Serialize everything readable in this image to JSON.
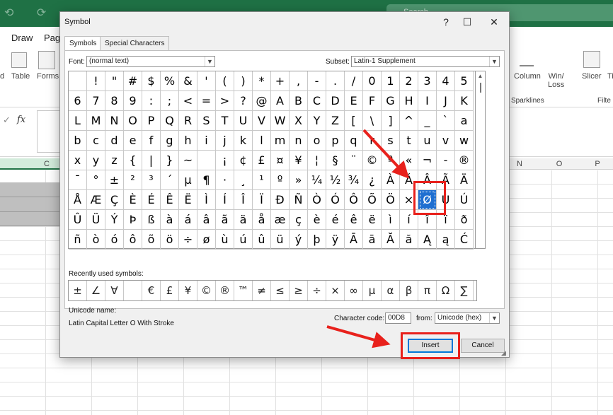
{
  "excel": {
    "menu": [
      "Draw",
      "Page"
    ],
    "search_text": "Search",
    "ribbon_left": {
      "table": "Table",
      "forms": "Forms"
    },
    "ribbon_right": {
      "column": "Column",
      "winloss": "Win/\nLoss",
      "slicer": "Slicer",
      "ti": "Ti"
    },
    "groups": {
      "sparklines": "Sparklines",
      "filters": "Filte"
    },
    "fx": "fx",
    "columns": {
      "c": "C",
      "n": "N",
      "o": "O",
      "p": "P"
    },
    "ribbon_d": "d"
  },
  "dialog": {
    "title": "Symbol",
    "tabs": [
      "Symbols",
      "Special Characters"
    ],
    "font_label": "Font:",
    "font_value": "(normal text)",
    "subset_label": "Subset:",
    "subset_value": "Latin-1 Supplement",
    "symbols": [
      [
        " ",
        "!",
        "\"",
        "#",
        "$",
        "%",
        "&",
        "'",
        "(",
        ")",
        "*",
        "+",
        ",",
        "-",
        ".",
        "/",
        "0",
        "1",
        "2",
        "3",
        "4",
        "5"
      ],
      [
        "6",
        "7",
        "8",
        "9",
        ":",
        ";",
        "<",
        "=",
        ">",
        "?",
        "@",
        "A",
        "B",
        "C",
        "D",
        "E",
        "F",
        "G",
        "H",
        "I",
        "J",
        "K"
      ],
      [
        "L",
        "M",
        "N",
        "O",
        "P",
        "Q",
        "R",
        "S",
        "T",
        "U",
        "V",
        "W",
        "X",
        "Y",
        "Z",
        "[",
        "\\",
        "]",
        "^",
        "_",
        "`",
        "a"
      ],
      [
        "b",
        "c",
        "d",
        "e",
        "f",
        "g",
        "h",
        "i",
        "j",
        "k",
        "l",
        "m",
        "n",
        "o",
        "p",
        "q",
        "r",
        "s",
        "t",
        "u",
        "v",
        "w"
      ],
      [
        "x",
        "y",
        "z",
        "{",
        "|",
        "}",
        "~",
        " ",
        "¡",
        "¢",
        "£",
        "¤",
        "¥",
        "¦",
        "§",
        "¨",
        "©",
        "ª",
        "«",
        "¬",
        "-",
        "®"
      ],
      [
        "¯",
        "°",
        "±",
        "²",
        "³",
        "´",
        "µ",
        "¶",
        "·",
        "¸",
        "¹",
        "º",
        "»",
        "¼",
        "½",
        "¾",
        "¿",
        "À",
        "Á",
        "Â",
        "Ã",
        "Ä"
      ],
      [
        "Å",
        "Æ",
        "Ç",
        "È",
        "É",
        "Ê",
        "Ë",
        "Ì",
        "Í",
        "Î",
        "Ï",
        "Ð",
        "Ñ",
        "Ò",
        "Ó",
        "Ô",
        "Õ",
        "Ö",
        "×",
        "Ø",
        "Ù",
        "Ú"
      ],
      [
        "Û",
        "Ü",
        "Ý",
        "Þ",
        "ß",
        "à",
        "á",
        "â",
        "ã",
        "ä",
        "å",
        "æ",
        "ç",
        "è",
        "é",
        "ê",
        "ë",
        "ì",
        "í",
        "î",
        "ï",
        "ð"
      ],
      [
        "ñ",
        "ò",
        "ó",
        "ô",
        "õ",
        "ö",
        "÷",
        "ø",
        "ù",
        "ú",
        "û",
        "ü",
        "ý",
        "þ",
        "ÿ",
        "Ā",
        "ā",
        "Ă",
        "ă",
        "Ą",
        "ą",
        "Ć"
      ]
    ],
    "selected_symbol": "Ø",
    "recent_label": "Recently used symbols:",
    "recent": [
      "±",
      "∠",
      "∀",
      " ",
      "€",
      "£",
      "¥",
      "©",
      "®",
      "™",
      "≠",
      "≤",
      "≥",
      "÷",
      "×",
      "∞",
      "µ",
      "α",
      "β",
      "π",
      "Ω",
      "∑"
    ],
    "unicode_name_label": "Unicode name:",
    "unicode_name": "Latin Capital Letter O With Stroke",
    "char_code_label": "Character code:",
    "char_code": "00D8",
    "from_label": "from:",
    "from_value": "Unicode (hex)",
    "insert_label": "Insert",
    "cancel_label": "Cancel"
  },
  "colors": {
    "excel_green": "#1f7145",
    "highlight_red": "#e8211c",
    "selection_blue": "#1f6fd0"
  }
}
